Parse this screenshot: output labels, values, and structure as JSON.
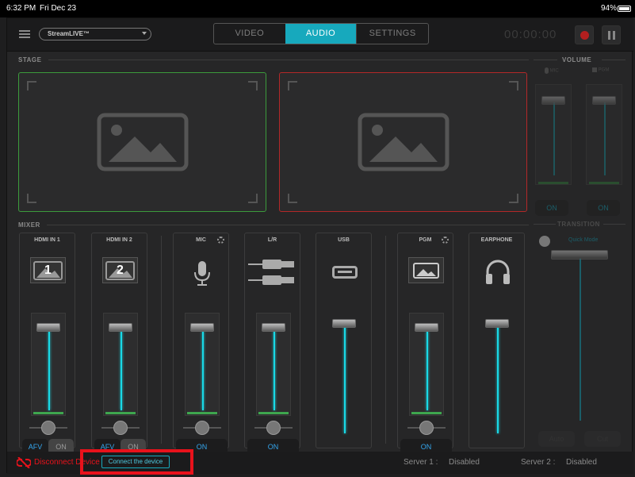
{
  "status": {
    "time": "6:32 PM",
    "date": "Fri Dec 23",
    "battery": "94%"
  },
  "header": {
    "device_select": "StreamLIVE™",
    "tabs": [
      {
        "label": "VIDEO"
      },
      {
        "label": "AUDIO"
      },
      {
        "label": "SETTINGS"
      }
    ],
    "timer": "00:00:00"
  },
  "stage": {
    "title": "STAGE"
  },
  "volume": {
    "title": "VOLUME",
    "mic_label": "MIC",
    "pgm_label": "PGM",
    "mic_on": "ON",
    "pgm_on": "ON"
  },
  "transition": {
    "title": "TRANSITION",
    "quick_mode": "Quick Mode",
    "auto": "Auto",
    "cut": "Cut"
  },
  "mixer": {
    "title": "MIXER",
    "channels": [
      {
        "name": "HDMI IN 1",
        "number": "1",
        "afv": "AFV",
        "on": "ON"
      },
      {
        "name": "HDMI IN 2",
        "number": "2",
        "afv": "AFV",
        "on": "ON"
      },
      {
        "name": "MIC",
        "on": "ON"
      },
      {
        "name": "L/R",
        "on": "ON"
      },
      {
        "name": "USB"
      },
      {
        "name": "PGM",
        "on": "ON"
      },
      {
        "name": "EARPHONE"
      }
    ]
  },
  "footer": {
    "disconnect": "Disconnect Device",
    "connect": "Connect the device",
    "server1_label": "Server 1 :",
    "server1_value": "Disabled",
    "server2_label": "Server 2 :",
    "server2_value": "Disabled"
  },
  "colors": {
    "accent": "#17a9bd",
    "stage_left": "#3c9b3c",
    "stage_right": "#b32828",
    "record": "#c22525",
    "alert": "#e8121b"
  }
}
